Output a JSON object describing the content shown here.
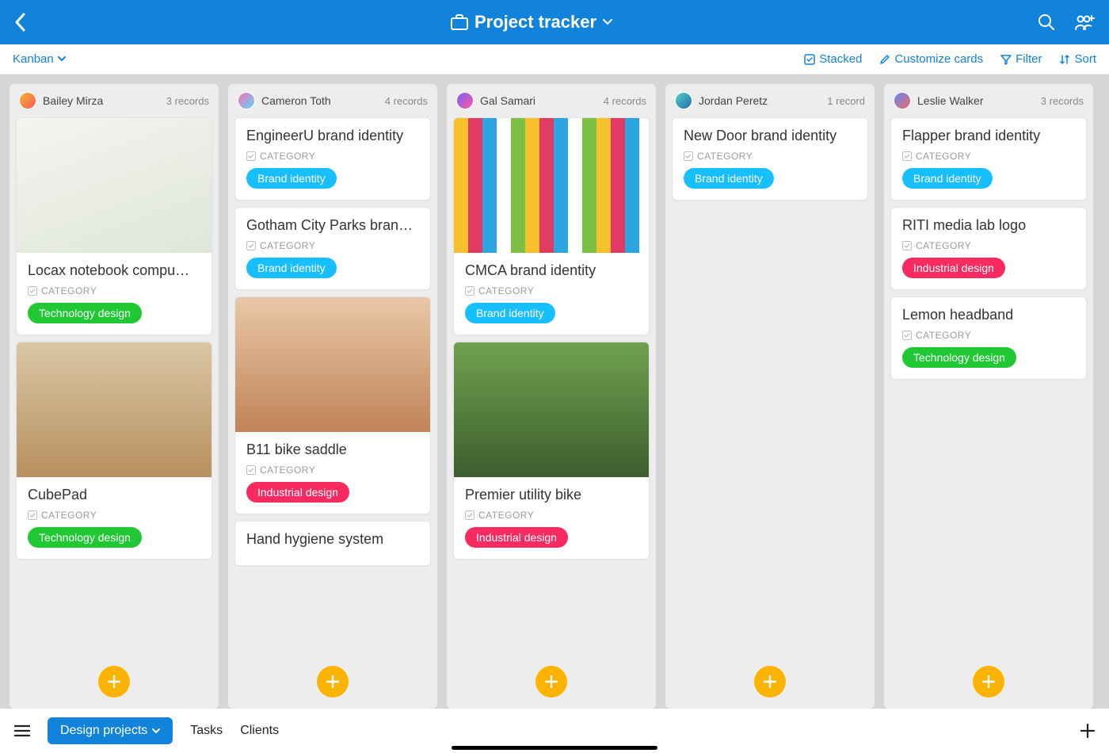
{
  "header": {
    "title": "Project tracker"
  },
  "subbar": {
    "view": "Kanban",
    "tools": {
      "stacked": "Stacked",
      "customize": "Customize cards",
      "filter": "Filter",
      "sort": "Sort"
    }
  },
  "labels": {
    "category": "CATEGORY"
  },
  "tags": {
    "technology_design": "Technology design",
    "brand_identity": "Brand identity",
    "industrial_design": "Industrial design"
  },
  "columns": [
    {
      "name": "Bailey Mirza",
      "count": "3 records",
      "avatar_colors": [
        "#f7b42c",
        "#fc575e"
      ],
      "cards": [
        {
          "title": "Locax notebook compu…",
          "tag": "technology_design",
          "image": "ph1"
        },
        {
          "title": "CubePad",
          "tag": "technology_design",
          "image": "ph3"
        }
      ]
    },
    {
      "name": "Cameron Toth",
      "count": "4 records",
      "avatar_colors": [
        "#ff6fb5",
        "#55d6ff"
      ],
      "cards": [
        {
          "title": "EngineerU brand identity",
          "tag": "brand_identity"
        },
        {
          "title": "Gotham City Parks bran…",
          "tag": "brand_identity"
        },
        {
          "title": "B11 bike saddle",
          "tag": "industrial_design",
          "image": "ph4"
        },
        {
          "title": "Hand hygiene system"
        }
      ]
    },
    {
      "name": "Gal Samari",
      "count": "4 records",
      "avatar_colors": [
        "#7b5cff",
        "#ff5c9d"
      ],
      "cards": [
        {
          "title": "CMCA brand identity",
          "tag": "brand_identity",
          "image": "ph2"
        },
        {
          "title": "Premier utility bike",
          "tag": "industrial_design",
          "image": "ph5"
        }
      ]
    },
    {
      "name": "Jordan Peretz",
      "count": "1 record",
      "avatar_colors": [
        "#4fd1c5",
        "#2b6cb0"
      ],
      "cards": [
        {
          "title": "New Door brand identity",
          "tag": "brand_identity"
        }
      ]
    },
    {
      "name": "Leslie Walker",
      "count": "3 records",
      "avatar_colors": [
        "#5b8df6",
        "#f56565"
      ],
      "cards": [
        {
          "title": "Flapper brand identity",
          "tag": "brand_identity"
        },
        {
          "title": "RITI media lab logo",
          "tag": "industrial_design"
        },
        {
          "title": "Lemon headband",
          "tag": "technology_design"
        }
      ]
    }
  ],
  "bottombar": {
    "active": "Design projects",
    "tabs": [
      "Tasks",
      "Clients"
    ]
  }
}
